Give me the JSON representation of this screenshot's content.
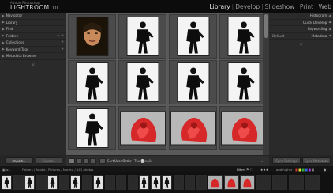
{
  "app": {
    "brand_small": "Adobe Photoshop",
    "brand_big": "LIGHTROOM",
    "version": "10"
  },
  "modules": [
    {
      "label": "Library",
      "active": true
    },
    {
      "label": "Develop",
      "active": false
    },
    {
      "label": "Slideshow",
      "active": false
    },
    {
      "label": "Print",
      "active": false
    },
    {
      "label": "Web",
      "active": false
    }
  ],
  "left_panel": {
    "sections": [
      {
        "label": "Navigator"
      },
      {
        "label": "Library"
      },
      {
        "label": "Find"
      },
      {
        "label": "Folders"
      },
      {
        "label": "Collections"
      },
      {
        "label": "Keyword Tags"
      },
      {
        "label": "Metadata Browser"
      }
    ]
  },
  "right_panel": {
    "sections": [
      {
        "label": "Histogram"
      },
      {
        "label": "Quick Develop"
      },
      {
        "label": "Keywording"
      },
      {
        "label": "Metadata",
        "left": "Default"
      }
    ]
  },
  "toolbar": {
    "sort_label": "Sort",
    "sort_value": "User Order",
    "thumbnails_label": "Thumbnails"
  },
  "buttons": {
    "import": "Import...",
    "export": "Export...",
    "sync_settings": "Sync Settings",
    "sync_metadata": "Sync Metadata"
  },
  "filmstrip_bar": {
    "path": "Folders / Adobe / Pictures / Monica / 141 photos",
    "filters_label": "Filters",
    "rating_filter": "and higher"
  },
  "grid": [
    [
      "face",
      "portrait",
      "portrait",
      "portrait"
    ],
    [
      "portrait",
      "portrait",
      "portrait",
      "portrait"
    ],
    [
      "portrait",
      "red",
      "red",
      "red"
    ]
  ],
  "filmstrip_thumbs": [
    "light",
    "dark",
    "light",
    "dark",
    "light",
    "dark",
    "light",
    "dark",
    "light",
    "dark",
    "dark",
    "dark",
    "light",
    "light",
    "light",
    "dark",
    "dark",
    "dark",
    "red",
    "red",
    "red",
    "dark",
    "dark",
    "dark",
    "dark",
    "dark",
    "dark",
    "dark",
    "dark",
    "dark"
  ]
}
